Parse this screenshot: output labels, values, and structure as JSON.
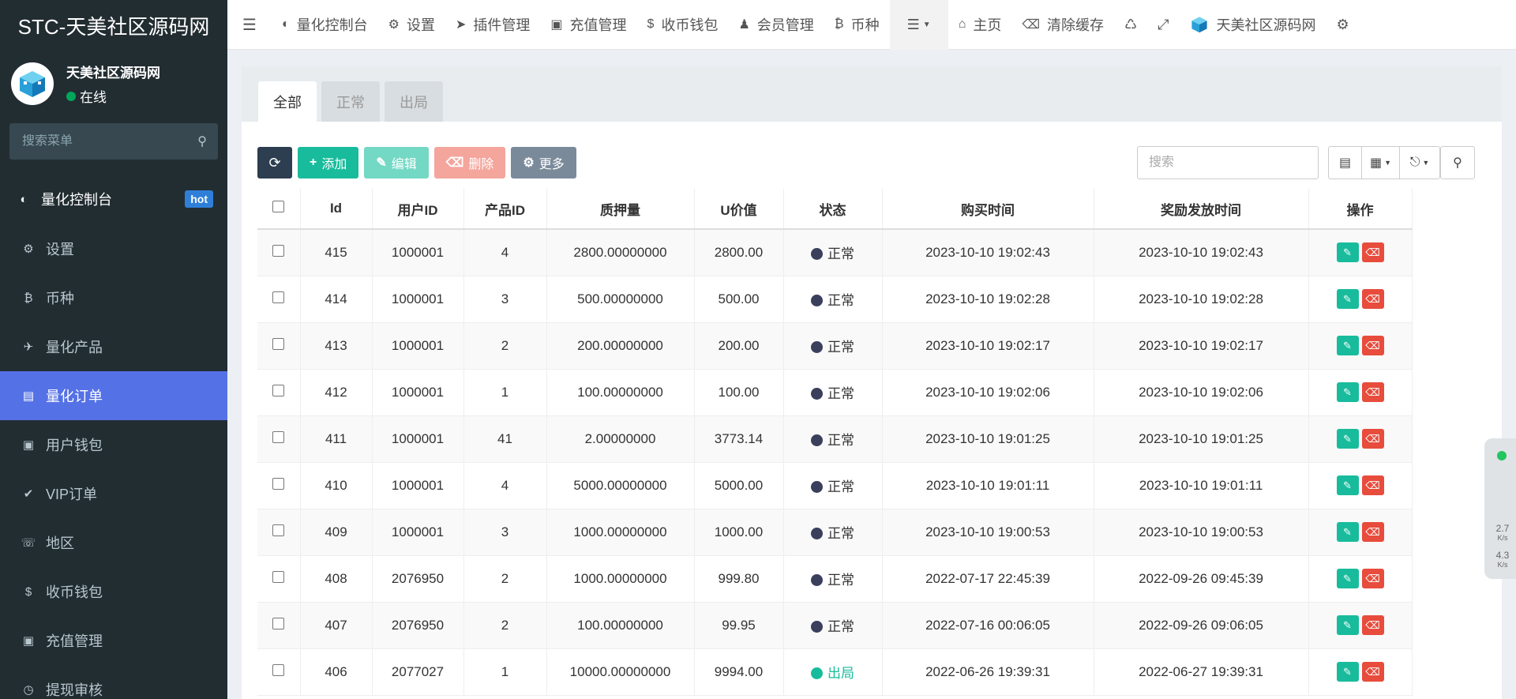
{
  "sidebar": {
    "brand": "STC-天美社区源码网",
    "user_name": "天美社区源码网",
    "user_status": "在线",
    "search_placeholder": "搜索菜单",
    "items": [
      {
        "label": "量化控制台",
        "badge": "hot",
        "icon": "dashboard-icon"
      },
      {
        "label": "设置",
        "icon": "gear-icon"
      },
      {
        "label": "币种",
        "icon": "bitcoin-icon"
      },
      {
        "label": "量化产品",
        "icon": "plane-icon"
      },
      {
        "label": "量化订单",
        "icon": "book-icon"
      },
      {
        "label": "用户钱包",
        "icon": "money-icon"
      },
      {
        "label": "VIP订单",
        "icon": "check-circle-icon"
      },
      {
        "label": "地区",
        "icon": "phone-icon"
      },
      {
        "label": "收币钱包",
        "icon": "dollar-icon"
      },
      {
        "label": "充值管理",
        "icon": "money-icon"
      },
      {
        "label": "提现审核",
        "icon": "clock-icon"
      }
    ]
  },
  "topbar": {
    "items": [
      {
        "label": "量化控制台",
        "icon": "dashboard-icon"
      },
      {
        "label": "设置",
        "icon": "gear-icon"
      },
      {
        "label": "插件管理",
        "icon": "rocket-icon"
      },
      {
        "label": "充值管理",
        "icon": "money-icon"
      },
      {
        "label": "收币钱包",
        "icon": "dollar-icon"
      },
      {
        "label": "会员管理",
        "icon": "user-icon"
      },
      {
        "label": "币种",
        "icon": "bitcoin-icon"
      }
    ],
    "home": "主页",
    "clear_cache": "清除缓存",
    "site_name": "天美社区源码网"
  },
  "tabs": [
    "全部",
    "正常",
    "出局"
  ],
  "toolbar": {
    "add": "添加",
    "edit": "编辑",
    "delete": "删除",
    "more": "更多",
    "search_placeholder": "搜索"
  },
  "table": {
    "columns": [
      "Id",
      "用户ID",
      "产品ID",
      "质押量",
      "U价值",
      "状态",
      "购买时间",
      "奖励发放时间",
      "操作"
    ],
    "rows": [
      {
        "id": "415",
        "user": "1000001",
        "product": "4",
        "amount": "2800.00000000",
        "uvalue": "2800.00",
        "status": "正常",
        "status_color": "#3a3f5c",
        "buy": "2023-10-10 19:02:43",
        "reward": "2023-10-10 19:02:43"
      },
      {
        "id": "414",
        "user": "1000001",
        "product": "3",
        "amount": "500.00000000",
        "uvalue": "500.00",
        "status": "正常",
        "status_color": "#3a3f5c",
        "buy": "2023-10-10 19:02:28",
        "reward": "2023-10-10 19:02:28"
      },
      {
        "id": "413",
        "user": "1000001",
        "product": "2",
        "amount": "200.00000000",
        "uvalue": "200.00",
        "status": "正常",
        "status_color": "#3a3f5c",
        "buy": "2023-10-10 19:02:17",
        "reward": "2023-10-10 19:02:17"
      },
      {
        "id": "412",
        "user": "1000001",
        "product": "1",
        "amount": "100.00000000",
        "uvalue": "100.00",
        "status": "正常",
        "status_color": "#3a3f5c",
        "buy": "2023-10-10 19:02:06",
        "reward": "2023-10-10 19:02:06"
      },
      {
        "id": "411",
        "user": "1000001",
        "product": "41",
        "amount": "2.00000000",
        "uvalue": "3773.14",
        "status": "正常",
        "status_color": "#3a3f5c",
        "buy": "2023-10-10 19:01:25",
        "reward": "2023-10-10 19:01:25"
      },
      {
        "id": "410",
        "user": "1000001",
        "product": "4",
        "amount": "5000.00000000",
        "uvalue": "5000.00",
        "status": "正常",
        "status_color": "#3a3f5c",
        "buy": "2023-10-10 19:01:11",
        "reward": "2023-10-10 19:01:11"
      },
      {
        "id": "409",
        "user": "1000001",
        "product": "3",
        "amount": "1000.00000000",
        "uvalue": "1000.00",
        "status": "正常",
        "status_color": "#3a3f5c",
        "buy": "2023-10-10 19:00:53",
        "reward": "2023-10-10 19:00:53"
      },
      {
        "id": "408",
        "user": "2076950",
        "product": "2",
        "amount": "1000.00000000",
        "uvalue": "999.80",
        "status": "正常",
        "status_color": "#3a3f5c",
        "buy": "2022-07-17 22:45:39",
        "reward": "2022-09-26 09:45:39"
      },
      {
        "id": "407",
        "user": "2076950",
        "product": "2",
        "amount": "100.00000000",
        "uvalue": "99.95",
        "status": "正常",
        "status_color": "#3a3f5c",
        "buy": "2022-07-16 00:06:05",
        "reward": "2022-09-26 09:06:05"
      },
      {
        "id": "406",
        "user": "2077027",
        "product": "1",
        "amount": "10000.00000000",
        "uvalue": "9994.00",
        "status": "出局",
        "status_color": "#18bc9c",
        "buy": "2022-06-26 19:39:31",
        "reward": "2022-06-27 19:39:31"
      }
    ]
  },
  "net_widget": {
    "up": "2.7",
    "up_unit": "K/s",
    "down": "4.3",
    "down_unit": "K/s"
  }
}
